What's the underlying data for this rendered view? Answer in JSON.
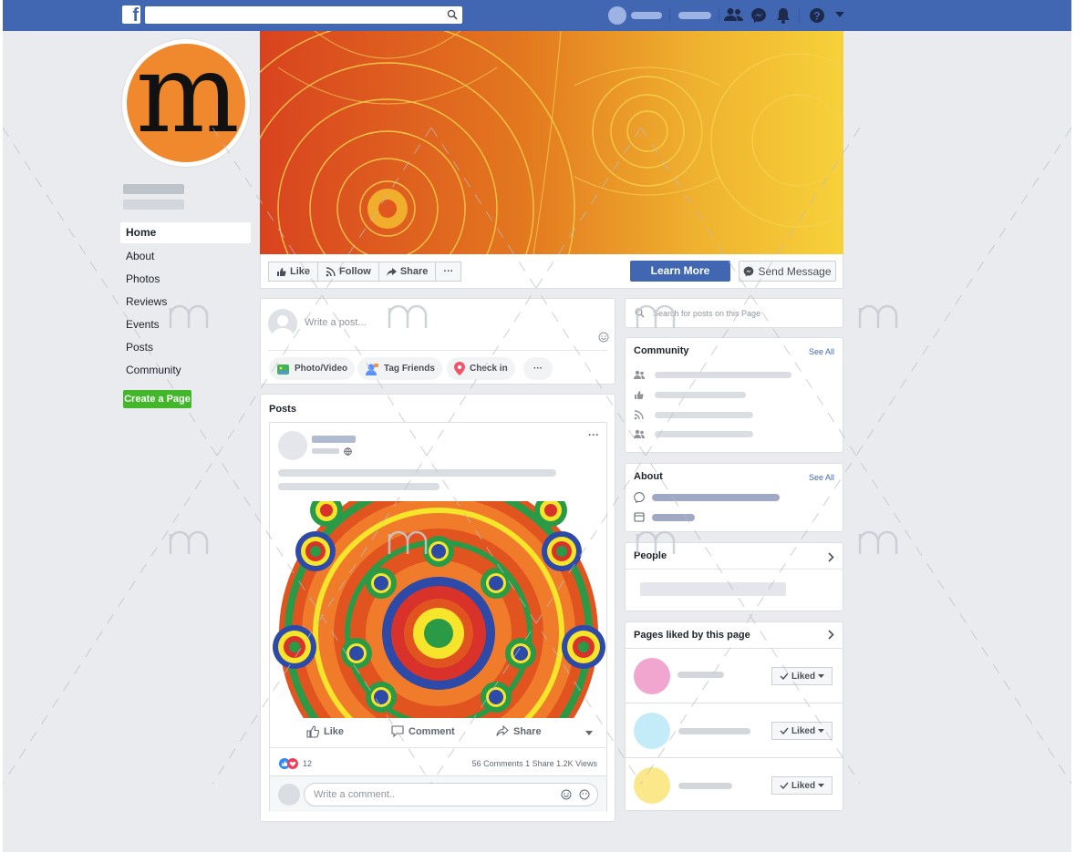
{
  "colors": {
    "brand_blue": "#4267b2",
    "page_bg": "#e9ebee",
    "create_green": "#42b72a",
    "profile_orange": "#f0892d"
  },
  "topbar": {
    "logo_letter": "f",
    "icons": [
      "facebook-logo-icon",
      "search-icon",
      "friends-icon",
      "messenger-icon",
      "bell-icon",
      "help-icon",
      "caret-down-icon"
    ]
  },
  "profile": {
    "logo_letter": "m"
  },
  "left_nav": {
    "items": [
      {
        "label": "Home",
        "active": true
      },
      {
        "label": "About"
      },
      {
        "label": "Photos"
      },
      {
        "label": "Reviews"
      },
      {
        "label": "Events"
      },
      {
        "label": "Posts"
      },
      {
        "label": "Community"
      }
    ],
    "create_page_label": "Create a Page"
  },
  "action_bar": {
    "like_label": "Like",
    "follow_label": "Follow",
    "share_label": "Share",
    "more_label": "···",
    "learn_more_label": "Learn More",
    "send_message_label": "Send Message"
  },
  "composer": {
    "placeholder": "Write a post...",
    "photo_video_label": "Photo/Video",
    "tag_friends_label": "Tag Friends",
    "check_in_label": "Check in",
    "more_label": "···"
  },
  "posts": {
    "title": "Posts",
    "more_label": "···",
    "like_label": "Like",
    "comment_label": "Comment",
    "share_label": "Share",
    "reactions_count": "12",
    "stats_text": "56 Comments  1 Share  1.2K Views",
    "comment_placeholder": "Write a comment.."
  },
  "right": {
    "search_placeholder": "Search for posts on this Page",
    "community_title": "Community",
    "about_title": "About",
    "see_all": "See All",
    "people_title": "People",
    "pages_liked_title": "Pages liked by this page",
    "liked_label": "Liked",
    "liked_pages": [
      {
        "color": "#f0a6cf"
      },
      {
        "color": "#c3ebf8"
      },
      {
        "color": "#fbe88a"
      }
    ]
  }
}
